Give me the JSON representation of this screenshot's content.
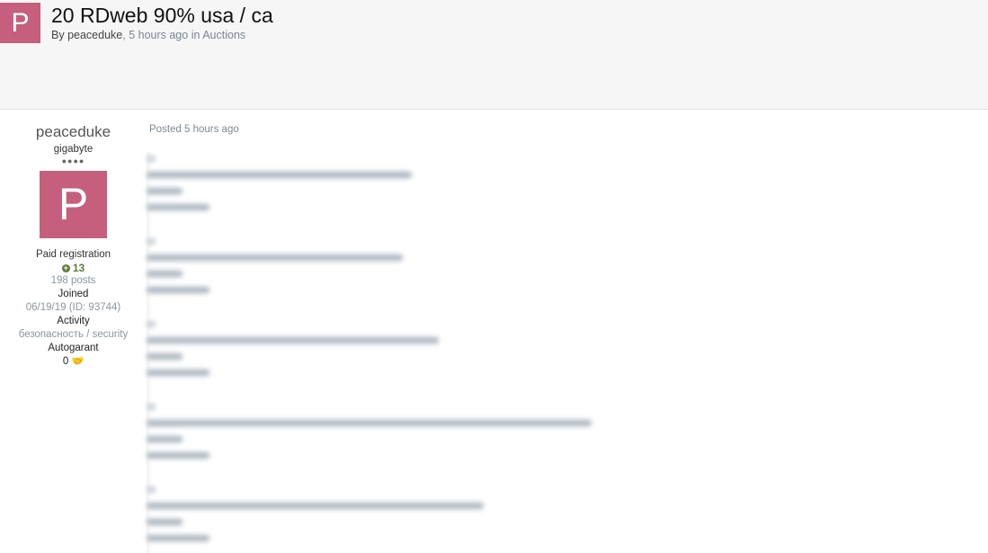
{
  "header": {
    "avatar_letter": "P",
    "title": "20 RDweb 90% usa / ca",
    "by_prefix": "By ",
    "author": "peaceduke",
    "comma": ", ",
    "time": "5 hours ago",
    "in_prefix": " in ",
    "forum": "Auctions"
  },
  "author": {
    "name": "peaceduke",
    "rank": "gigabyte",
    "rank_pips": "●●●●",
    "avatar_letter": "P",
    "group": "Paid registration",
    "reputation": "13",
    "posts": "198 posts",
    "joined_label": "Joined",
    "joined_value": "06/19/19 (ID: 93744)",
    "activity_label": "Activity",
    "activity_value": "безопасность / security",
    "autogarant_label": "Autogarant",
    "autogarant_value": "0"
  },
  "post": {
    "posted": "Posted 5 hours ago"
  },
  "icons": {
    "reputation": "plus-circle-icon",
    "autogarant": "handshake-icon"
  },
  "colors": {
    "avatar_bg": "#c65f7d",
    "reputation": "#5b7b3a",
    "link_muted": "#7a8894"
  }
}
